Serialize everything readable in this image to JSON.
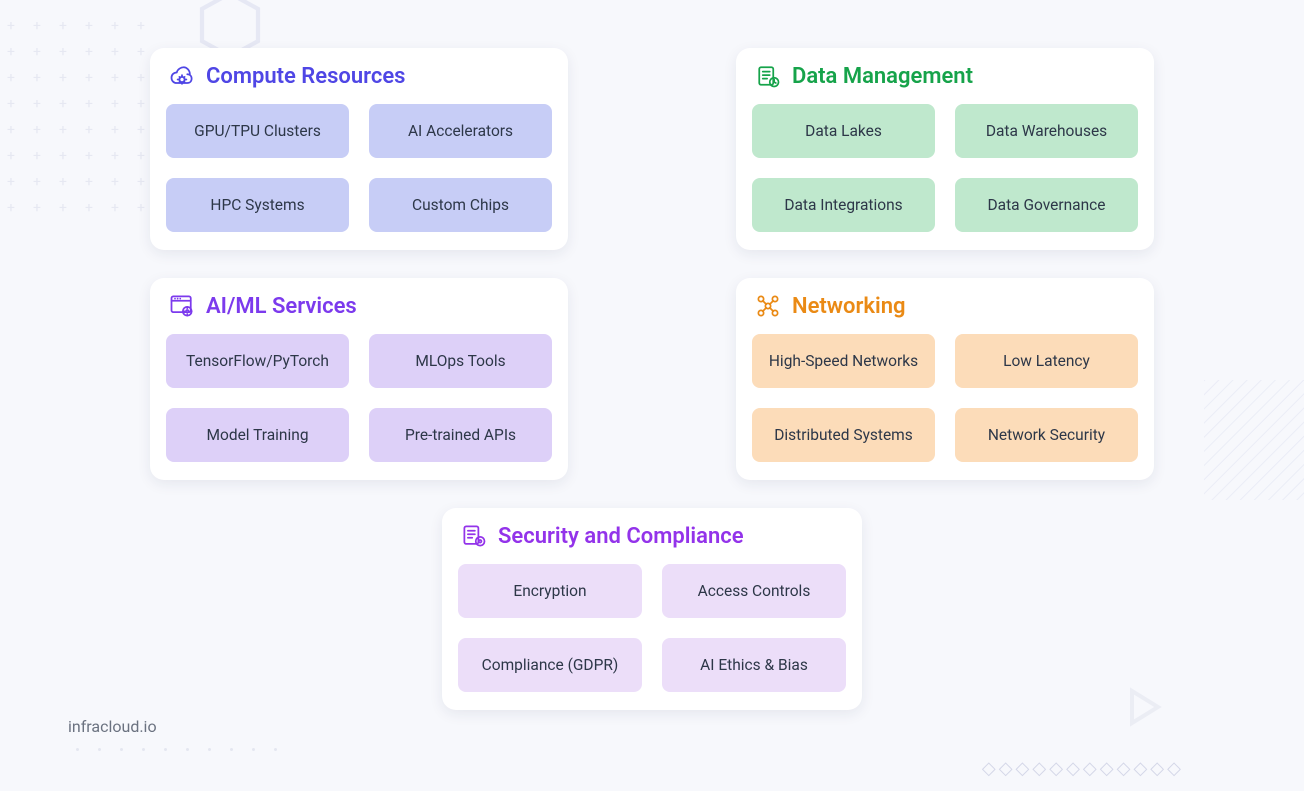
{
  "watermark": "infracloud.io",
  "cards": {
    "compute": {
      "title": "Compute Resources",
      "tiles": [
        "GPU/TPU Clusters",
        "AI Accelerators",
        "HPC Systems",
        "Custom Chips"
      ]
    },
    "aiml": {
      "title": "AI/ML Services",
      "tiles": [
        "TensorFlow/PyTorch",
        "MLOps Tools",
        "Model Training",
        "Pre-trained APIs"
      ]
    },
    "data": {
      "title": "Data Management",
      "tiles": [
        "Data Lakes",
        "Data Warehouses",
        "Data Integrations",
        "Data Governance"
      ]
    },
    "networking": {
      "title": "Networking",
      "tiles": [
        "High-Speed Networks",
        "Low Latency",
        "Distributed Systems",
        "Network Security"
      ]
    },
    "security": {
      "title": "Security and Compliance",
      "tiles": [
        "Encryption",
        "Access Controls",
        "Compliance (GDPR)",
        "AI Ethics & Bias"
      ]
    }
  }
}
